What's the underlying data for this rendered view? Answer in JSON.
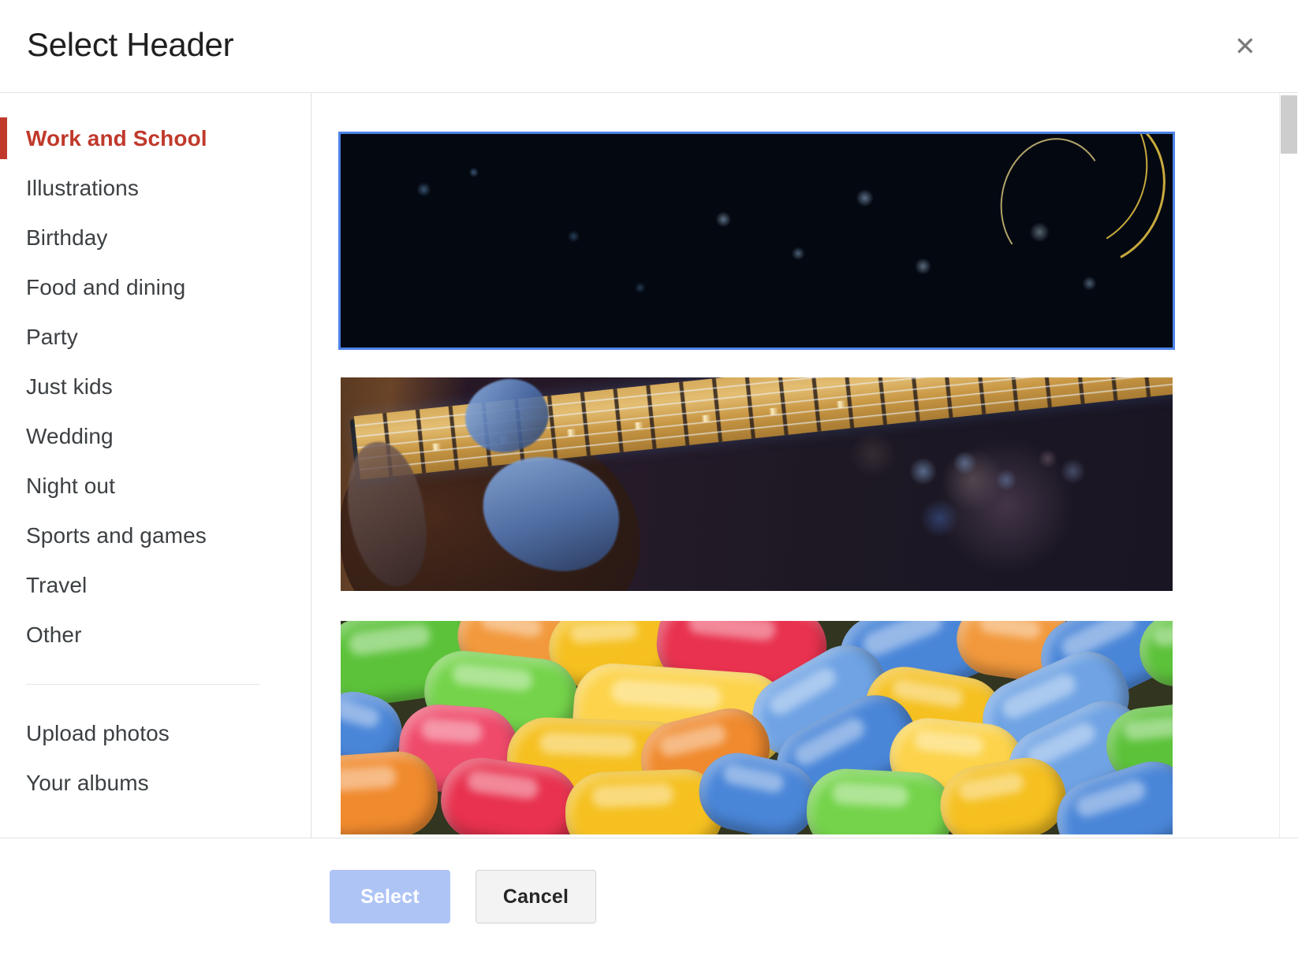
{
  "dialog": {
    "title": "Select Header",
    "close_icon": "close-icon",
    "close_glyph": "✕"
  },
  "sidebar": {
    "categories": [
      {
        "label": "Work and School",
        "active": true
      },
      {
        "label": "Illustrations",
        "active": false
      },
      {
        "label": "Birthday",
        "active": false
      },
      {
        "label": "Food and dining",
        "active": false
      },
      {
        "label": "Party",
        "active": false
      },
      {
        "label": "Just kids",
        "active": false
      },
      {
        "label": "Wedding",
        "active": false
      },
      {
        "label": "Night out",
        "active": false
      },
      {
        "label": "Sports and games",
        "active": false
      },
      {
        "label": "Travel",
        "active": false
      },
      {
        "label": "Other",
        "active": false
      }
    ],
    "sources": [
      {
        "label": "Upload photos"
      },
      {
        "label": "Your albums"
      }
    ],
    "active_color": "#c0392b"
  },
  "gallery": {
    "selection_color": "#4d82e8",
    "thumbnails": [
      {
        "name": "fiber-optic-lights-header",
        "description": "Dark blue fiber optic cables with bokeh light streaks and yellow strands",
        "selected": true
      },
      {
        "name": "electric-guitar-header",
        "description": "Hands playing an electric guitar fretboard under blue stage lighting",
        "selected": false
      },
      {
        "name": "colorful-candy-header",
        "description": "Close-up of colorful candy coated sweets in green, yellow, red, blue and orange",
        "selected": false
      }
    ]
  },
  "footer": {
    "select_label": "Select",
    "cancel_label": "Cancel",
    "select_color": "#aec4f5",
    "cancel_color": "#f3f3f3"
  },
  "scrollbar": {
    "name": "vertical-scrollbar",
    "thumb_color": "#cdcdcd"
  }
}
